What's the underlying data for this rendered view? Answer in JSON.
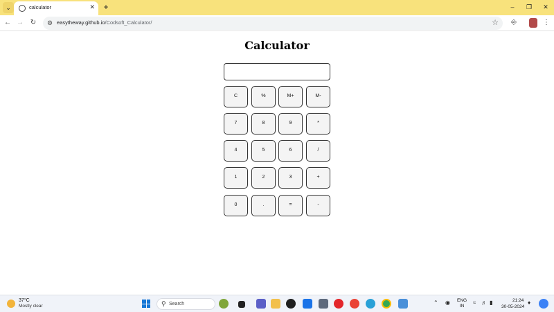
{
  "browser": {
    "tab": {
      "title": "calculator"
    },
    "address": {
      "host": "easytheway.github.io",
      "path": "/Codsoft_Calculator/"
    }
  },
  "page": {
    "title": "Calculator",
    "display_value": "",
    "keys": [
      [
        "C",
        "%",
        "M+",
        "M-"
      ],
      [
        "7",
        "8",
        "9",
        "*"
      ],
      [
        "4",
        "5",
        "6",
        "/"
      ],
      [
        "1",
        "2",
        "3",
        "+"
      ],
      [
        "0",
        ".",
        "=",
        "-"
      ]
    ]
  },
  "taskbar": {
    "weather": {
      "temp": "37°C",
      "desc": "Mostly clear"
    },
    "search_label": "Search",
    "language": {
      "line1": "ENG",
      "line2": "IN"
    },
    "time": "21:24",
    "date": "30-05-2024"
  }
}
